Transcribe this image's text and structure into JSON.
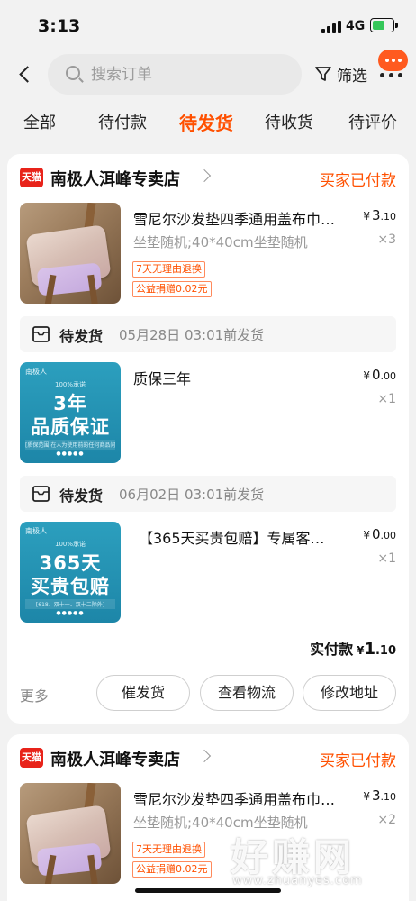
{
  "status_bar": {
    "time": "3:13",
    "network": "4G",
    "battery": 0.6
  },
  "nav": {
    "search_placeholder": "搜索订单",
    "filter_label": "筛选",
    "back_icon": "chevron-left-icon",
    "filter_icon": "funnel-icon",
    "more_icon": "more-dots-icon"
  },
  "tabs": [
    {
      "label": "全部",
      "active": false
    },
    {
      "label": "待付款",
      "active": false
    },
    {
      "label": "待发货",
      "active": true
    },
    {
      "label": "待收货",
      "active": false
    },
    {
      "label": "待评价",
      "active": false
    }
  ],
  "colors": {
    "accent": "#ff5000",
    "tmall_red": "#e8231a",
    "promo_blue": "#1d86a8"
  },
  "orders": [
    {
      "shop_logo": "天猫",
      "shop_name": "南极人洱峰专卖店",
      "status": "买家已付款",
      "items": [
        {
          "title": "雪尼尔沙发垫四季通用盖布巾…",
          "price_int": "3",
          "price_dec": ".10",
          "spec": "坐垫随机;40*40cm坐垫随机",
          "qty": "×3",
          "tags": [
            "7天无理由退换",
            "公益捐赠0.02元"
          ]
        },
        {
          "ship_label": "待发货",
          "ship_date": "05月28日 03:01前发货",
          "title": "质保三年",
          "price_int": "0",
          "price_dec": ".00",
          "qty": "×1",
          "promo": {
            "brand": "南极人",
            "top": "100%承诺",
            "line1": "3年",
            "line2": "品质保证",
            "small": "[质保范围:在人为使用前的任何商品问题]",
            "dots": "●●●●●"
          }
        },
        {
          "ship_label": "待发货",
          "ship_date": "06月02日 03:01前发货",
          "title": "【365天买贵包赔】专属客…",
          "price_int": "0",
          "price_dec": ".00",
          "qty": "×1",
          "promo": {
            "brand": "南极人",
            "top": "100%承诺",
            "line1": "365天",
            "line2": "买贵包赔",
            "small": "[618、双十一、双十二除外]",
            "dots": "●●●●●"
          }
        }
      ],
      "paid_label": "实付款",
      "paid_int": "1",
      "paid_dec": ".10",
      "more_label": "更多",
      "actions": [
        "催发货",
        "查看物流",
        "修改地址"
      ]
    },
    {
      "shop_logo": "天猫",
      "shop_name": "南极人洱峰专卖店",
      "status": "买家已付款",
      "items": [
        {
          "title": "雪尼尔沙发垫四季通用盖布巾…",
          "price_int": "3",
          "price_dec": ".10",
          "spec": "坐垫随机;40*40cm坐垫随机",
          "qty": "×2",
          "tags": [
            "7天无理由退换",
            "公益捐赠0.02元"
          ]
        }
      ]
    }
  ],
  "currency": "¥",
  "watermark": {
    "text": "好赚网",
    "url": "www.zhuanyes.com"
  }
}
